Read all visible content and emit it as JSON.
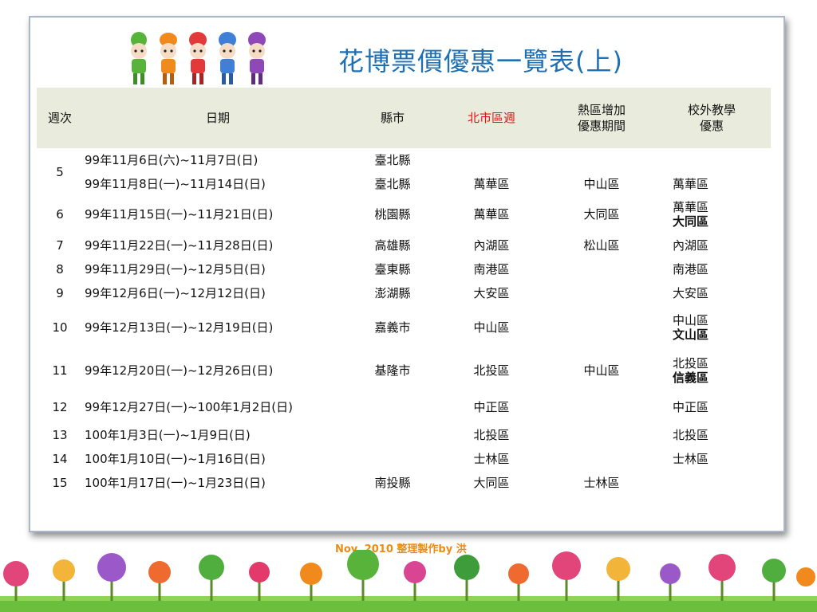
{
  "title": "花博票價優惠一覽表(上)",
  "footer": "Nov. 2010 整理製作by 洪",
  "headers": {
    "week": "週次",
    "date": "日期",
    "county": "縣市",
    "taipei_week": "北市區週",
    "hot_area_line1": "熱區增加",
    "hot_area_line2": "優惠期間",
    "field_trip_line1": "校外教學",
    "field_trip_line2": "優惠"
  },
  "rows": [
    {
      "week": "5",
      "date": "99年11月6日(六)~11月7日(日)",
      "county": "臺北縣",
      "district": "",
      "hot": "",
      "trip": []
    },
    {
      "week": "",
      "date": "99年11月8日(一)~11月14日(日)",
      "county": "臺北縣",
      "district": "萬華區",
      "hot": "中山區",
      "trip": [
        {
          "text": "萬華區",
          "bold": false
        }
      ]
    },
    {
      "week": "6",
      "date": "99年11月15日(一)~11月21日(日)",
      "county": "桃園縣",
      "district": "萬華區",
      "hot": "大同區",
      "trip": [
        {
          "text": "萬華區",
          "bold": false
        },
        {
          "text": "大同區",
          "bold": true
        }
      ]
    },
    {
      "week": "7",
      "date": "99年11月22日(一)~11月28日(日)",
      "county": "高雄縣",
      "district": "內湖區",
      "hot": "松山區",
      "trip": [
        {
          "text": "內湖區",
          "bold": false
        }
      ]
    },
    {
      "week": "8",
      "date": "99年11月29日(一)~12月5日(日)",
      "county": "臺東縣",
      "district": "南港區",
      "hot": "",
      "trip": [
        {
          "text": "南港區",
          "bold": false
        }
      ]
    },
    {
      "week": "9",
      "date": "99年12月6日(一)~12月12日(日)",
      "county": "澎湖縣",
      "district": "大安區",
      "hot": "",
      "trip": [
        {
          "text": "大安區",
          "bold": false
        }
      ]
    },
    {
      "week": "10",
      "date": "99年12月13日(一)~12月19日(日)",
      "county": "嘉義市",
      "district": "中山區",
      "hot": "",
      "trip": [
        {
          "text": "中山區",
          "bold": false
        },
        {
          "text": "文山區",
          "bold": true
        }
      ]
    },
    {
      "week": "11",
      "date": "99年12月20日(一)~12月26日(日)",
      "county": "基隆市",
      "district": "北投區",
      "hot": "中山區",
      "trip": [
        {
          "text": "北投區",
          "bold": false
        },
        {
          "text": "信義區",
          "bold": true
        }
      ]
    },
    {
      "week": "12",
      "date": "99年12月27日(一)~100年1月2日(日)",
      "county": "",
      "district": "中正區",
      "hot": "",
      "trip": [
        {
          "text": "中正區",
          "bold": false
        }
      ]
    },
    {
      "week": "13",
      "date": "100年1月3日(一)~1月9日(日)",
      "county": "",
      "district": "北投區",
      "hot": "",
      "trip": [
        {
          "text": "北投區",
          "bold": false
        }
      ]
    },
    {
      "week": "14",
      "date": "100年1月10日(一)~1月16日(日)",
      "county": "",
      "district": "士林區",
      "hot": "",
      "trip": [
        {
          "text": "士林區",
          "bold": false
        }
      ]
    },
    {
      "week": "15",
      "date": "100年1月17日(一)~1月23日(日)",
      "county": "南投縣",
      "district": "大同區",
      "hot": "士林區",
      "trip": []
    }
  ],
  "colors": {
    "title": "#1f6fb3",
    "header_bg": "#e9ecdc",
    "header_highlight": "#e81010",
    "footer": "#ef8a12",
    "panel_border": "#a9b7c9"
  }
}
